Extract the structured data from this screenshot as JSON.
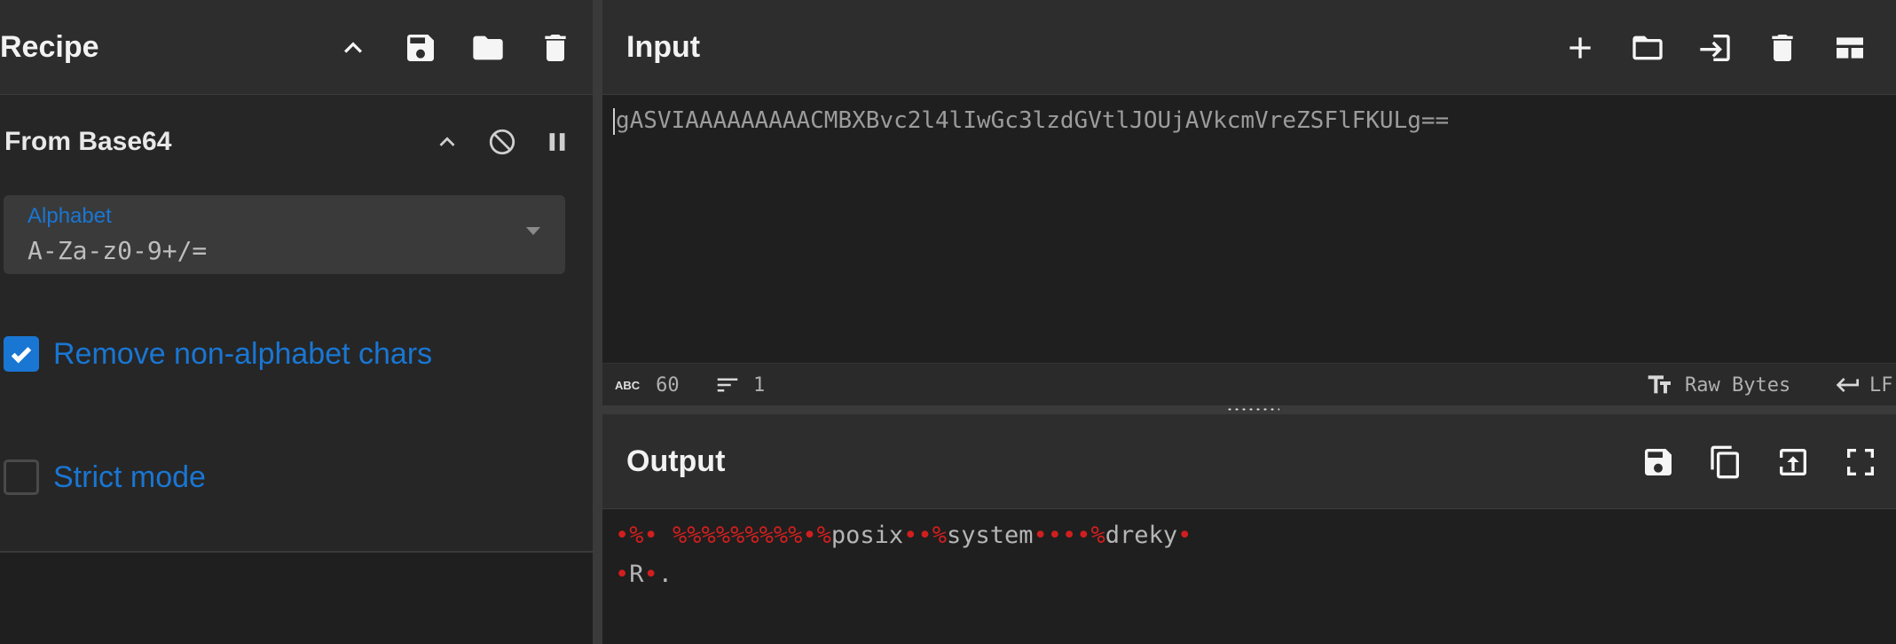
{
  "recipe": {
    "title": "Recipe",
    "icons": [
      "chevron-up-icon",
      "save-icon",
      "folder-icon",
      "trash-icon"
    ]
  },
  "operation": {
    "title": "From Base64",
    "icons": [
      "chevron-up-icon",
      "disable-icon",
      "pause-icon"
    ],
    "alphabet_label": "Alphabet",
    "alphabet_value": "A-Za-z0-9+/=",
    "remove_label": "Remove non-alphabet chars",
    "remove_checked": true,
    "strict_label": "Strict mode",
    "strict_checked": false
  },
  "input": {
    "title": "Input",
    "icons": [
      "plus-icon",
      "folder-icon",
      "sign-in-icon",
      "trash-icon",
      "layout-icon"
    ],
    "text": "gASVIAAAAAAAAACMBXBvc2l4lIwGc3lzdGVtlJOUjAVkcmVreZSFlFKULg=="
  },
  "status": {
    "chars": "60",
    "lines": "1",
    "encoding": "Raw Bytes",
    "eol": "LF"
  },
  "output": {
    "title": "Output",
    "icons": [
      "save-icon",
      "copy-icon",
      "replace-input-icon",
      "fullscreen-icon"
    ],
    "line1_parts": [
      {
        "t": "•",
        "c": "r"
      },
      {
        "t": "%",
        "c": "r"
      },
      {
        "t": "• ",
        "c": "r"
      },
      {
        "t": "%%%%%%%%%",
        "c": "r"
      },
      {
        "t": "•",
        "c": "r"
      },
      {
        "t": "%",
        "c": "r"
      },
      {
        "t": "posix",
        "c": ""
      },
      {
        "t": "••",
        "c": "r"
      },
      {
        "t": "%",
        "c": "r"
      },
      {
        "t": "system",
        "c": ""
      },
      {
        "t": "••••",
        "c": "r"
      },
      {
        "t": "%",
        "c": "r"
      },
      {
        "t": "dreky",
        "c": ""
      },
      {
        "t": "•",
        "c": "r"
      }
    ],
    "line2_parts": [
      {
        "t": "•",
        "c": "r"
      },
      {
        "t": "R",
        "c": ""
      },
      {
        "t": "•",
        "c": "r"
      },
      {
        "t": ".",
        "c": ""
      }
    ]
  }
}
